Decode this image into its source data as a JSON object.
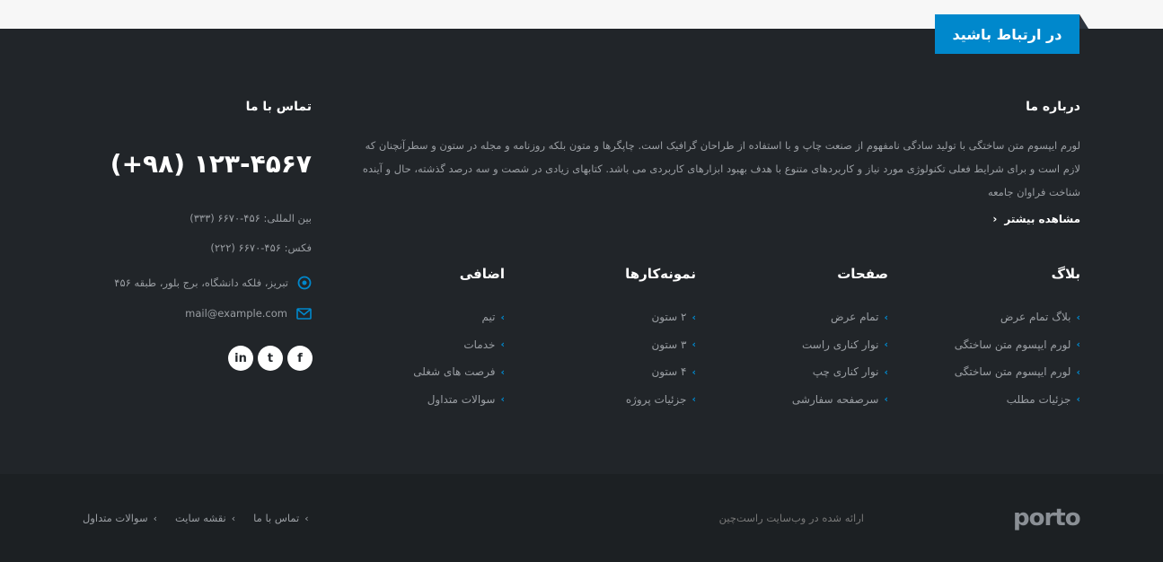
{
  "header": {
    "tab_label": "در ارتباط باشید"
  },
  "about": {
    "title": "درباره ما",
    "text": "لورم ایپسوم متن ساختگی با تولید سادگی نامفهوم از صنعت چاپ و با استفاده از طراحان گرافیک است. چاپگرها و متون بلکه روزنامه و مجله در ستون و سطرآنچنان که لازم است و برای شرایط فعلی تکنولوژی مورد نیاز و کاربردهای متنوع با هدف بهبود ابزارهای کاربردی می باشد. کتابهای زیادی در شصت و سه درصد گذشته، حال و آینده شناخت فراوان جامعه",
    "more_label": "مشاهده بیشتر",
    "more_arrow": "‹"
  },
  "columns": [
    {
      "title": "بلاگ",
      "items": [
        "بلاگ تمام عرض",
        "لورم ایپسوم متن ساختگی",
        "لورم ایپسوم متن ساختگی",
        "جزئیات مطلب"
      ]
    },
    {
      "title": "صفحات",
      "items": [
        "تمام عرض",
        "نوار کناری راست",
        "نوار کناری چپ",
        "سرصفحه سفارشی"
      ]
    },
    {
      "title": "نمونه‌کارها",
      "items": [
        "۲ ستون",
        "۳ ستون",
        "۴ ستون",
        "جزئیات پروژه"
      ]
    },
    {
      "title": "اضافی",
      "items": [
        "تیم",
        "خدمات",
        "فرصت های شغلی",
        "سوالات متداول"
      ]
    }
  ],
  "contact": {
    "title": "تماس با ما",
    "phone": "(+۹۸) ۱۲۳-۴۵۶۷",
    "international": "بین المللی: ۴۵۶-۶۶۷۰ (۳۳۳)",
    "fax": "فکس: ۴۵۶-۶۶۷۰ (۲۲۲)",
    "address": "تبریز، فلکه دانشگاه، برج بلور، طبقه ۴۵۶",
    "email": "mail@example.com"
  },
  "social": {
    "facebook": "f",
    "twitter": "t",
    "linkedin": "in"
  },
  "bottom": {
    "links": [
      "تماس با ما",
      "نقشه سایت",
      "سوالات متداول"
    ],
    "copyright": "ارائه شده در وب‌سایت راست‌چین",
    "logo": "porto"
  },
  "colors": {
    "accent": "#0088cc",
    "background": "#212529",
    "bottom_bar": "#1c2023",
    "muted_text": "#9a9ea3"
  },
  "icons": {
    "list_arrow": "chevron-left-icon",
    "location": "location-pin-icon",
    "email": "envelope-icon"
  }
}
